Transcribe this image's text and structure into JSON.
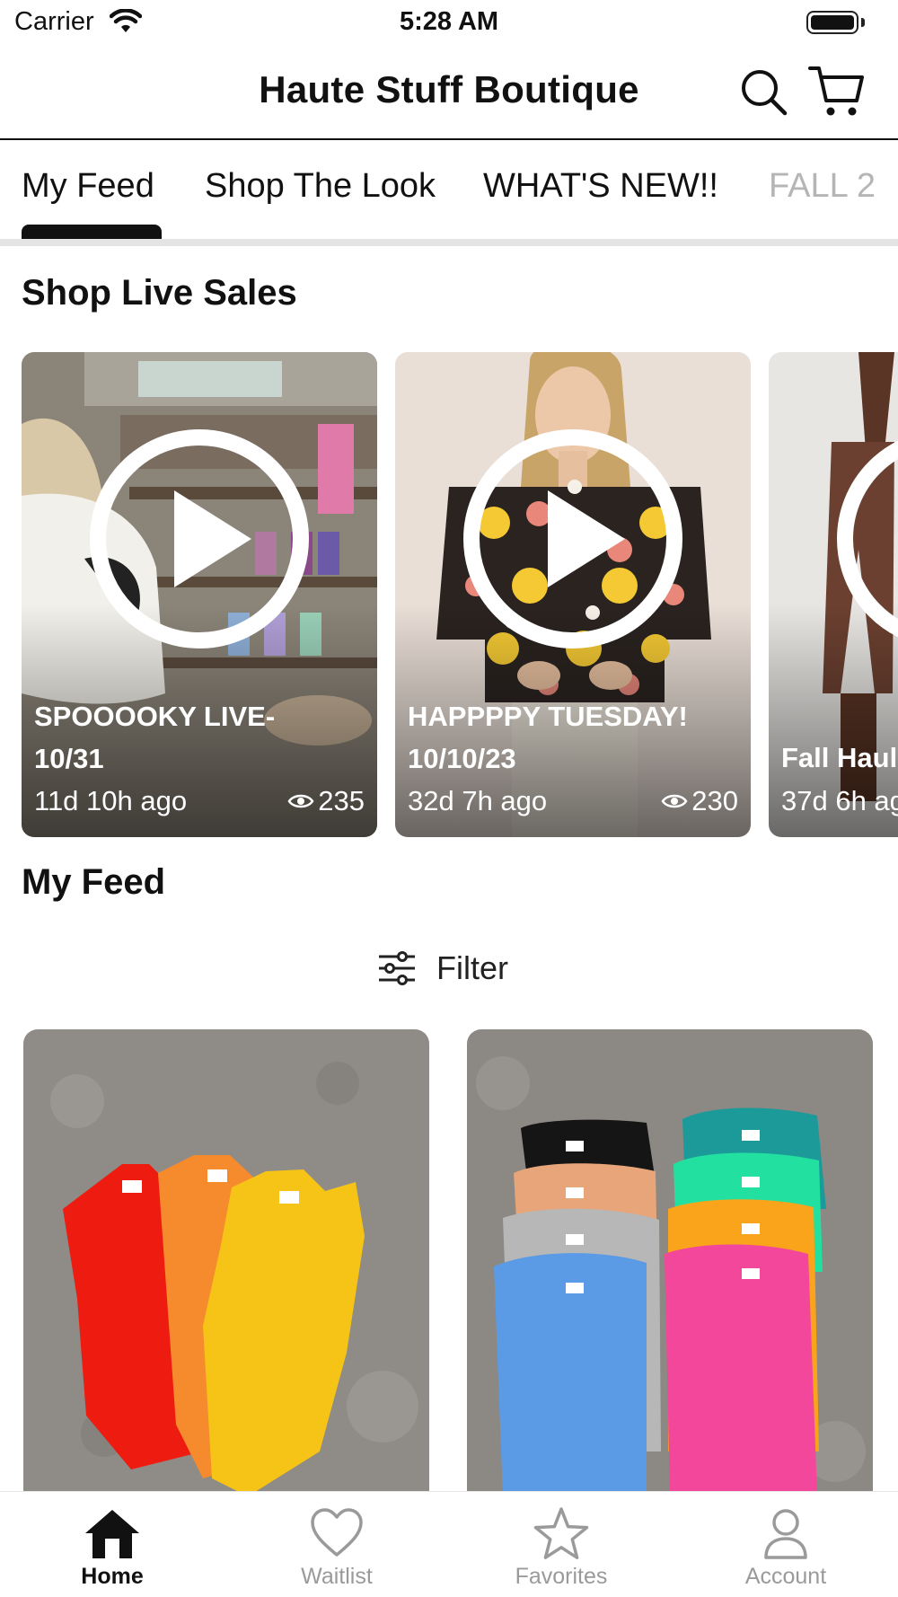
{
  "status_bar": {
    "carrier": "Carrier",
    "time": "5:28 AM"
  },
  "header": {
    "title": "Haute Stuff Boutique",
    "search_icon": "search-icon",
    "cart_icon": "cart-icon"
  },
  "tabs": [
    {
      "label": "My Feed",
      "active": true
    },
    {
      "label": "Shop The Look"
    },
    {
      "label": "WHAT'S NEW!!"
    },
    {
      "label": "FALL 2"
    }
  ],
  "live_sales": {
    "title": "Shop Live Sales",
    "items": [
      {
        "title": "SPOOOOKY LIVE-\n10/31",
        "ago": "11d 10h ago",
        "views": "235"
      },
      {
        "title": "HAPPPPY TUESDAY!\n10/10/23",
        "ago": "32d 7h ago",
        "views": "230"
      },
      {
        "title": "Fall Haul",
        "ago": "37d 6h ago",
        "views": ""
      }
    ]
  },
  "feed": {
    "title": "My Feed",
    "filter_label": "Filter"
  },
  "bottom_nav": [
    {
      "label": "Home",
      "icon": "home-icon",
      "active": true
    },
    {
      "label": "Waitlist",
      "icon": "heart-icon"
    },
    {
      "label": "Favorites",
      "icon": "star-icon"
    },
    {
      "label": "Account",
      "icon": "person-icon"
    }
  ],
  "colors": {
    "accent": "#111111",
    "inactive": "#9a9a9a",
    "divider": "#e4e4e4"
  }
}
